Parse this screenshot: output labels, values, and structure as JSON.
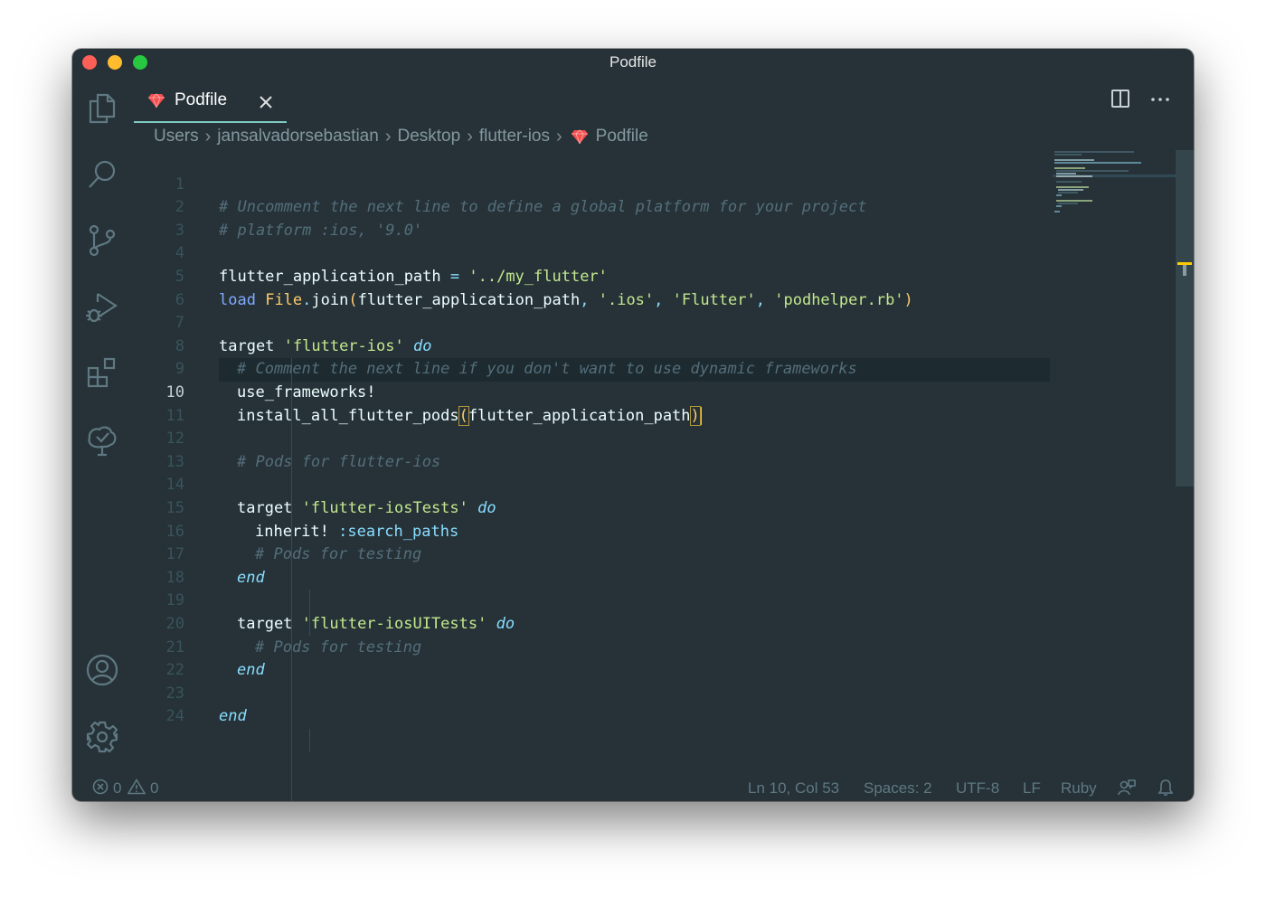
{
  "window": {
    "title": "Podfile"
  },
  "tab": {
    "label": "Podfile"
  },
  "breadcrumb": {
    "items": [
      "Users",
      "jansalvadorsebastian",
      "Desktop",
      "flutter-ios",
      "Podfile"
    ]
  },
  "colors": {
    "accent": "#80cbc4",
    "background": "#263238",
    "cursor": "#ffcc00",
    "ruby_icon": "#f54e4e"
  },
  "editor": {
    "active_line": 10,
    "line_numbers": [
      "1",
      "2",
      "3",
      "4",
      "5",
      "6",
      "7",
      "8",
      "9",
      "10",
      "11",
      "12",
      "13",
      "14",
      "15",
      "16",
      "17",
      "18",
      "19",
      "20",
      "21",
      "22",
      "23",
      "24"
    ],
    "lines": [
      {
        "text": "# Uncomment the next line to define a global platform for your project"
      },
      {
        "text": "# platform :ios, '9.0'"
      },
      {
        "text": ""
      },
      {
        "t1": "flutter_application_path ",
        "t2": "=",
        "t3": " ",
        "t4": "'../my_flutter'"
      },
      {
        "t1": "load",
        "t2": " ",
        "t3": "File",
        "t4": ".",
        "t5": "join",
        "t6": "(",
        "t7": "flutter_application_path",
        "t8": ", ",
        "t9": "'.ios'",
        "t10": ", ",
        "t11": "'Flutter'",
        "t12": ", ",
        "t13": "'podhelper.rb'",
        "t14": ")"
      },
      {
        "text": ""
      },
      {
        "t1": "target ",
        "t2": "'flutter-ios'",
        "t3": " ",
        "t4": "do"
      },
      {
        "text": "# Comment the next line if you don't want to use dynamic frameworks"
      },
      {
        "text": "use_frameworks!"
      },
      {
        "t1": "install_all_flutter_pods",
        "t2": "(",
        "t3": "flutter_application_path",
        "t4": ")"
      },
      {
        "text": ""
      },
      {
        "text": "# Pods for flutter-ios"
      },
      {
        "text": ""
      },
      {
        "t1": "target ",
        "t2": "'flutter-iosTests'",
        "t3": " ",
        "t4": "do"
      },
      {
        "t1": "inherit! ",
        "t2": ":search_paths"
      },
      {
        "text": "# Pods for testing"
      },
      {
        "text": "end"
      },
      {
        "text": ""
      },
      {
        "t1": "target ",
        "t2": "'flutter-iosUITests'",
        "t3": " ",
        "t4": "do"
      },
      {
        "text": "# Pods for testing"
      },
      {
        "text": "end"
      },
      {
        "text": ""
      },
      {
        "text": "end"
      },
      {
        "text": ""
      }
    ]
  },
  "statusbar": {
    "errors": "0",
    "warnings": "0",
    "position": "Ln 10, Col 53",
    "spaces": "Spaces: 2",
    "encoding": "UTF-8",
    "eol": "LF",
    "language": "Ruby"
  },
  "icons": {
    "activity": [
      "files-icon",
      "search-icon",
      "source-control-icon",
      "run-debug-icon",
      "extensions-icon",
      "test-tree-icon",
      "account-icon",
      "settings-gear-icon"
    ],
    "toolbar": [
      "split-editor-icon",
      "more-actions-icon"
    ],
    "status": [
      "error-icon",
      "warning-icon",
      "feedback-icon",
      "bell-icon"
    ],
    "file": "ruby-gem-icon"
  }
}
